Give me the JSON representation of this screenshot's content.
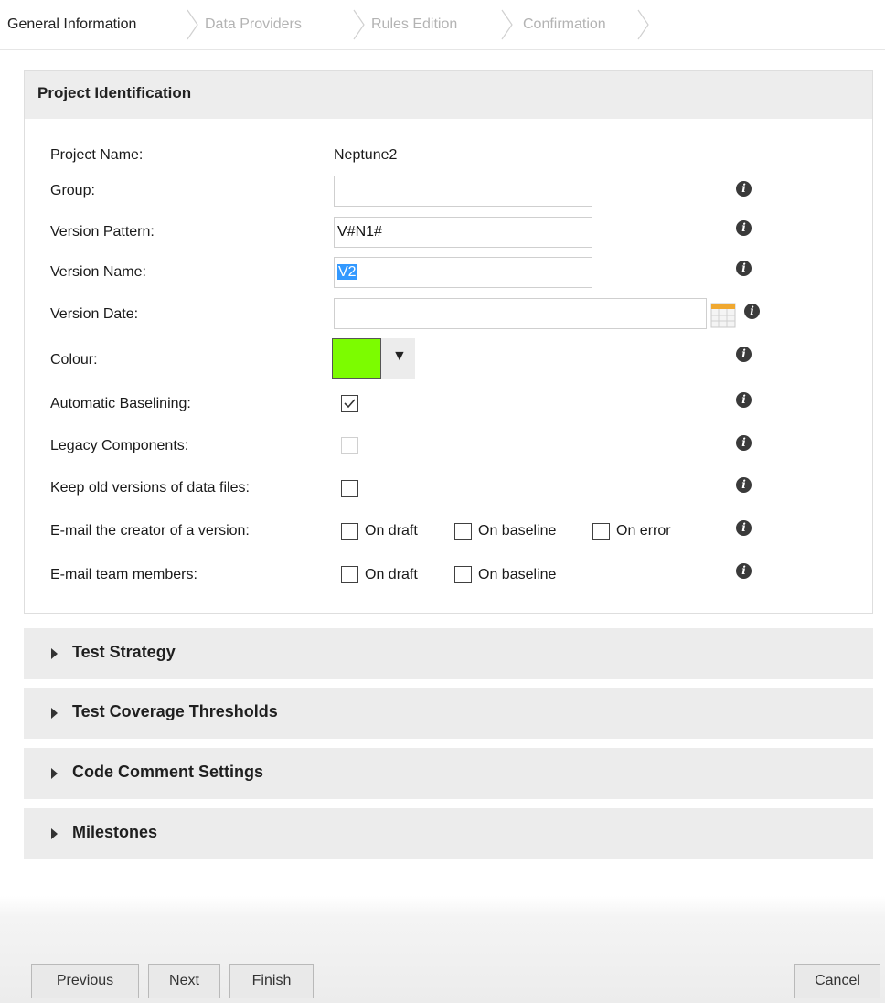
{
  "wizard": {
    "steps": [
      {
        "label": "General Information",
        "active": true
      },
      {
        "label": "Data Providers",
        "active": false
      },
      {
        "label": "Rules Edition",
        "active": false
      },
      {
        "label": "Confirmation",
        "active": false
      }
    ]
  },
  "panel": {
    "title": "Project Identification",
    "project_name_label": "Project Name:",
    "project_name_value": "Neptune2",
    "group_label": "Group:",
    "group_value": "",
    "version_pattern_label": "Version Pattern:",
    "version_pattern_value": "V#N1#",
    "version_name_label": "Version Name:",
    "version_name_value": "V2",
    "version_date_label": "Version Date:",
    "version_date_value": "",
    "colour_label": "Colour:",
    "colour_value": "#7cfc00",
    "auto_baselining_label": "Automatic Baselining:",
    "auto_baselining_checked": true,
    "legacy_components_label": "Legacy Components:",
    "legacy_components_checked": false,
    "keep_old_label": "Keep old versions of data files:",
    "keep_old_checked": false,
    "email_creator_label": "E-mail the creator of a version:",
    "email_team_label": "E-mail team members:",
    "on_draft": "On draft",
    "on_baseline": "On baseline",
    "on_error": "On error",
    "info_glyph": "i"
  },
  "sections": [
    {
      "title": "Test Strategy"
    },
    {
      "title": "Test Coverage Thresholds"
    },
    {
      "title": "Code Comment Settings"
    },
    {
      "title": "Milestones"
    }
  ],
  "footer": {
    "previous": "Previous",
    "next": "Next",
    "finish": "Finish",
    "cancel": "Cancel"
  },
  "colors": {
    "accent_selection": "#3399ff",
    "colour_swatch": "#7cfc00",
    "calendar_icon": "#f0a830"
  },
  "icons": [
    "info-icon",
    "calendar-icon",
    "dropdown-arrow-icon",
    "checkmark-icon",
    "expand-arrow-icon"
  ]
}
